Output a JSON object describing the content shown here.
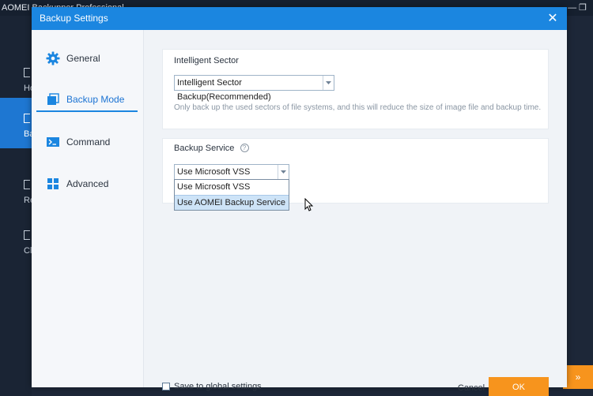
{
  "background_app": {
    "title": "AOMEI Backupper Professional",
    "window_controls": "—  ❐",
    "nav": [
      {
        "label": "Home",
        "active": false
      },
      {
        "label": "Backup",
        "active": true
      },
      {
        "label": "Restore",
        "active": false
      },
      {
        "label": "Clone",
        "active": false
      }
    ],
    "right_button": "»"
  },
  "dialog": {
    "title": "Backup Settings",
    "close_glyph": "✕",
    "nav": [
      {
        "label": "General",
        "icon": "gear-icon"
      },
      {
        "label": "Backup Mode",
        "icon": "backup-mode-icon"
      },
      {
        "label": "Command",
        "icon": "command-icon"
      },
      {
        "label": "Advanced",
        "icon": "grid-icon"
      }
    ],
    "active_nav": "Backup Mode",
    "intelligent_sector": {
      "title": "Intelligent Sector",
      "selected": "Intelligent Sector Backup(Recommended)",
      "hint": "Only back up the used sectors of file systems, and this will reduce the size of image file and backup time."
    },
    "backup_service": {
      "title": "Backup Service",
      "help_glyph": "?",
      "selected": "Use Microsoft VSS",
      "options": [
        "Use Microsoft VSS",
        "Use AOMEI Backup Service"
      ],
      "hovered_option": "Use AOMEI Backup Service"
    },
    "footer": {
      "save_global_label": "Save to global settings",
      "cancel_label": "Cancel",
      "ok_label": "OK"
    }
  },
  "colors": {
    "title_bar": "#1b86e0",
    "accent": "#f7941d",
    "active_nav": "#1b73d3"
  }
}
